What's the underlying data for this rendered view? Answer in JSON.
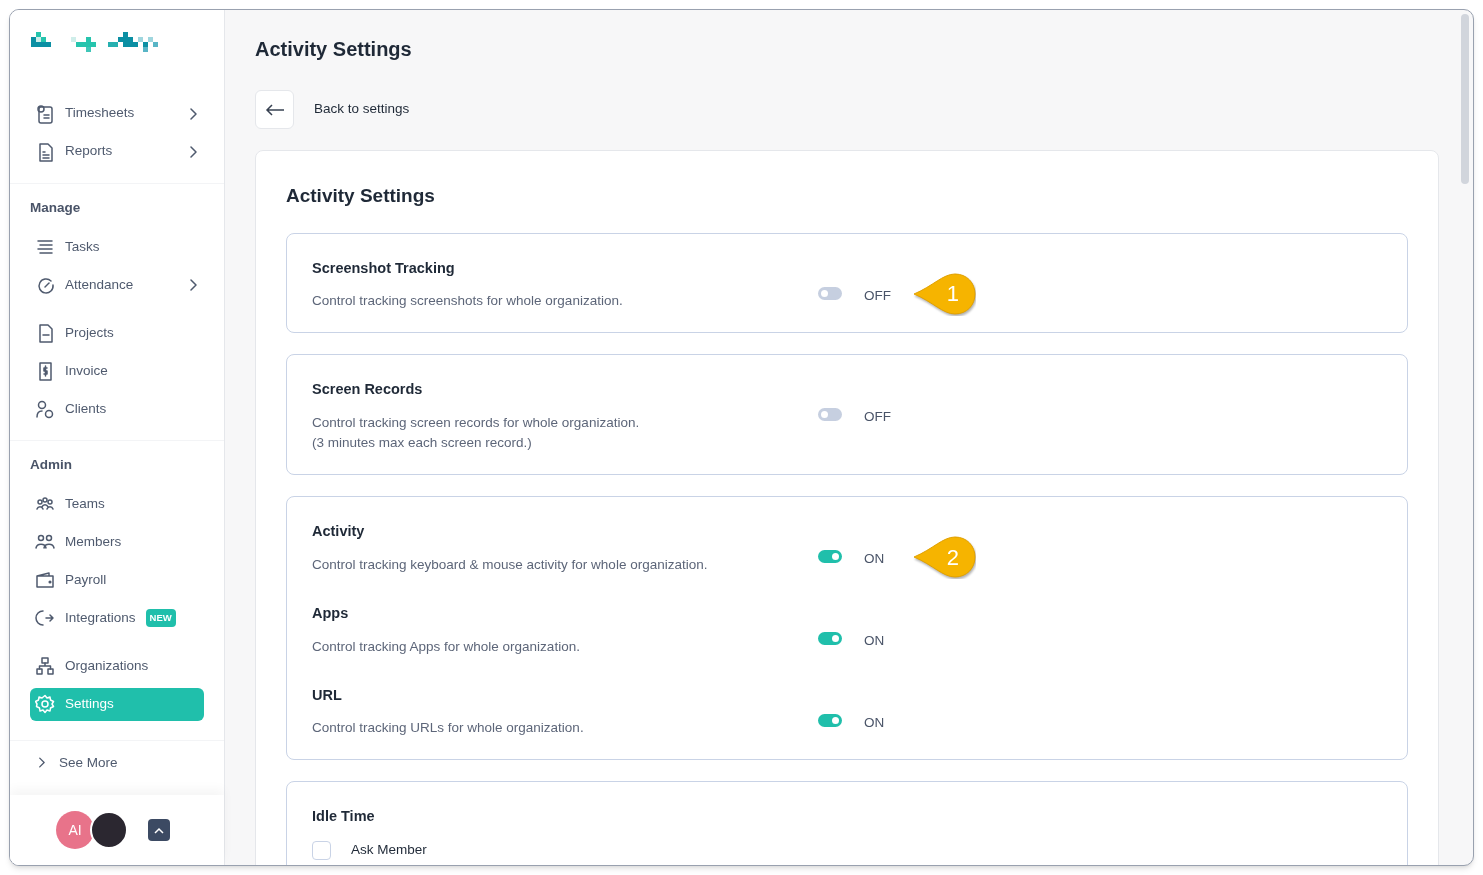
{
  "sidebar": {
    "sections": [
      {
        "groups": [
          [
            {
              "label": "Timesheets",
              "chevron": true,
              "selected": false
            },
            {
              "label": "Reports",
              "chevron": true,
              "selected": false
            }
          ]
        ]
      },
      {
        "heading": "Manage",
        "groups": [
          [
            {
              "label": "Tasks",
              "chevron": false,
              "selected": false
            },
            {
              "label": "Attendance",
              "chevron": true,
              "selected": false
            }
          ],
          [
            {
              "label": "Projects",
              "chevron": false,
              "selected": false
            },
            {
              "label": "Invoice",
              "chevron": false,
              "selected": false
            },
            {
              "label": "Clients",
              "chevron": false,
              "selected": false
            }
          ]
        ]
      },
      {
        "heading": "Admin",
        "groups": [
          [
            {
              "label": "Teams",
              "chevron": false,
              "selected": false
            },
            {
              "label": "Members",
              "chevron": false,
              "selected": false
            },
            {
              "label": "Payroll",
              "chevron": false,
              "selected": false
            },
            {
              "label": "Integrations",
              "badge": "NEW",
              "chevron": false,
              "selected": false
            }
          ],
          [
            {
              "label": "Organizations",
              "chevron": false,
              "selected": false
            },
            {
              "label": "Settings",
              "chevron": false,
              "selected": true
            }
          ]
        ]
      }
    ],
    "see_more": "See More",
    "footer": {
      "initials": "AI"
    }
  },
  "page_title": "Activity Settings",
  "back": {
    "label": "Back to settings"
  },
  "card": {
    "title": "Activity Settings",
    "panels": [
      {
        "settings": [
          {
            "kind": "toggle",
            "title": "Screenshot Tracking",
            "description": [
              "Control tracking screenshots for whole organization."
            ],
            "on": false,
            "state_text": "OFF",
            "callout": "1"
          }
        ]
      },
      {
        "settings": [
          {
            "kind": "toggle",
            "title": "Screen Records",
            "description": [
              "Control tracking screen records for whole organization.",
              "(3 minutes max each screen record.)"
            ],
            "on": false,
            "state_text": "OFF"
          }
        ]
      },
      {
        "settings": [
          {
            "kind": "toggle",
            "title": "Activity",
            "description": [
              "Control tracking keyboard & mouse activity for whole organization."
            ],
            "on": true,
            "state_text": "ON",
            "callout": "2"
          },
          {
            "kind": "toggle",
            "title": "Apps",
            "description": [
              "Control tracking Apps for whole organization."
            ],
            "on": true,
            "state_text": "ON"
          },
          {
            "kind": "toggle",
            "title": "URL",
            "description": [
              "Control tracking URLs for whole organization."
            ],
            "on": true,
            "state_text": "ON"
          }
        ]
      },
      {
        "title": "Idle Time",
        "settings": [
          {
            "kind": "checkbox",
            "label": "Ask Member",
            "checked": false
          }
        ]
      }
    ]
  }
}
